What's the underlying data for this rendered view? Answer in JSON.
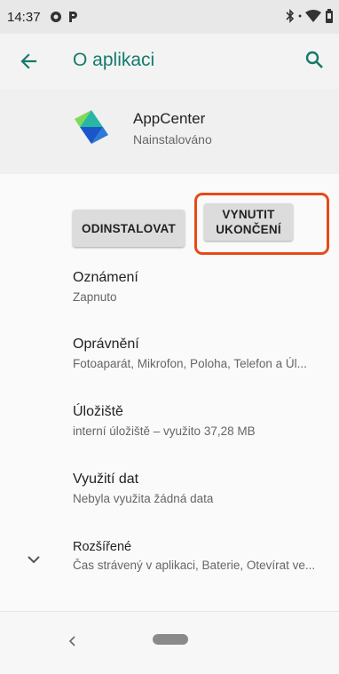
{
  "status_bar": {
    "time": "14:37",
    "icons": [
      "shield-icon",
      "p-app-icon",
      "bluetooth-icon",
      "wifi-icon",
      "battery-icon"
    ]
  },
  "app_bar": {
    "title": "O aplikaci",
    "back_icon": "arrow-back-icon",
    "search_icon": "search-icon",
    "accent": "#147a6b"
  },
  "app_header": {
    "name": "AppCenter",
    "status": "Nainstalováno"
  },
  "actions": {
    "uninstall_label": "ODINSTALOVAT",
    "force_stop_line1": "VYNUTIT",
    "force_stop_line2": "UKONČENÍ",
    "highlight_color": "#e64a19"
  },
  "settings": [
    {
      "title": "Oznámení",
      "subtitle": "Zapnuto"
    },
    {
      "title": "Oprávnění",
      "subtitle": "Fotoaparát, Mikrofon, Poloha, Telefon a Úl..."
    },
    {
      "title": "Úložiště",
      "subtitle": "interní úložiště – využito 37,28 MB"
    },
    {
      "title": "Využití dat",
      "subtitle": "Nebyla využita žádná data"
    },
    {
      "title": "Rozšířené",
      "subtitle": "Čas strávený v aplikaci, Baterie, Otevírat ve..."
    }
  ],
  "nav_bar": {
    "icons": [
      "nav-back-icon",
      "home-pill-icon"
    ]
  }
}
